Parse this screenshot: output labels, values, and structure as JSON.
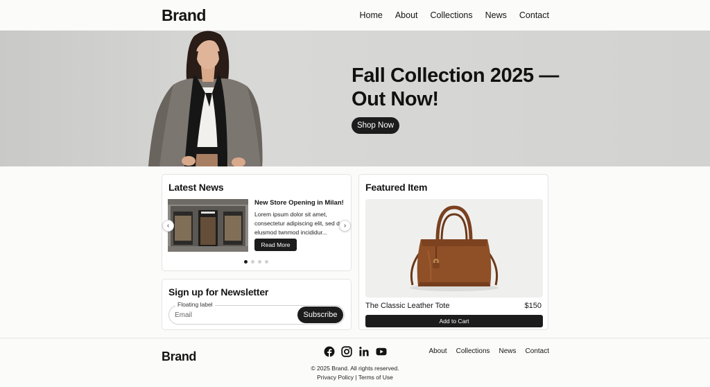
{
  "header": {
    "brand": "Brand",
    "nav": [
      "Home",
      "About",
      "Collections",
      "News",
      "Contact"
    ]
  },
  "hero": {
    "title": "Fall Collection 2025 — Out Now!",
    "button": "Shop Now"
  },
  "latest_news": {
    "heading": "Latest News",
    "article_title": "New Store Opening in Milan!",
    "article_excerpt": "Lorem ipsum dolor sit amet, consectetur adipiscing elit, sed do elusmod twnmod incididur...",
    "read_more": "Read More",
    "prev_icon": "chevron-left-icon",
    "next_icon": "chevron-right-icon",
    "slide_count": 4,
    "active_slide": 1
  },
  "newsletter": {
    "heading": "Sign up for Newsletter",
    "floating_label": "Floating label",
    "placeholder": "Email",
    "button": "Subscribe"
  },
  "featured": {
    "heading": "Featured Item",
    "product_name": "The Classic Leather Tote",
    "price": "$150",
    "button": "Add to Cart"
  },
  "footer": {
    "brand": "Brand",
    "socials": [
      "facebook-icon",
      "instagram-icon",
      "linkedin-icon",
      "youtube-icon"
    ],
    "nav": [
      "About",
      "Collections",
      "News",
      "Contact"
    ],
    "copyright": "© 2025 Brand. All rights reserved.",
    "privacy": "Privacy Policy",
    "separator": " | ",
    "terms": "Terms of Use"
  },
  "colors": {
    "primary": "#1c1c1c",
    "background": "#fbfbfa",
    "card_border": "#e4e4e2",
    "bag_leather": "#8f4f27"
  }
}
